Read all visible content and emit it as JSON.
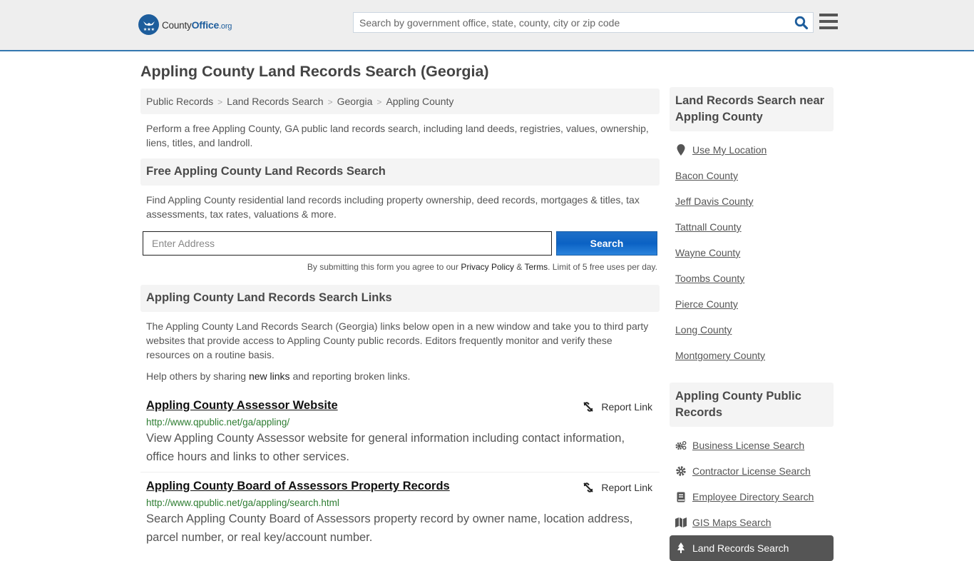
{
  "header": {
    "logo": {
      "county": "County",
      "office": "Office",
      "tld": ".org"
    },
    "search_placeholder": "Search by government office, state, county, city or zip code",
    "accent_color": "#1d5d9c"
  },
  "page_title": "Appling County Land Records Search (Georgia)",
  "breadcrumb": [
    "Public Records",
    "Land Records Search",
    "Georgia",
    "Appling County"
  ],
  "intro": "Perform a free Appling County, GA public land records search, including land deeds, registries, values, ownership, liens, titles, and landroll.",
  "free_search": {
    "heading": "Free Appling County Land Records Search",
    "description": "Find Appling County residential land records including property ownership, deed records, mortgages & titles, tax assessments, tax rates, valuations & more.",
    "address_placeholder": "Enter Address",
    "button_label": "Search",
    "terms_prefix": "By submitting this form you agree to our ",
    "privacy_label": "Privacy Policy",
    "amp": " & ",
    "terms_label": "Terms",
    "terms_suffix": ". Limit of 5 free uses per day."
  },
  "links_section": {
    "heading": "Appling County Land Records Search Links",
    "description": "The Appling County Land Records Search (Georgia) links below open in a new window and take you to third party websites that provide access to Appling County public records. Editors frequently monitor and verify these resources on a routine basis.",
    "help_prefix": "Help others by sharing ",
    "help_link": "new links",
    "help_suffix": " and reporting broken links.",
    "report_label": "Report Link",
    "items": [
      {
        "title": "Appling County Assessor Website",
        "url": "http://www.qpublic.net/ga/appling/",
        "description": "View Appling County Assessor website for general information including contact information, office hours and links to other services."
      },
      {
        "title": "Appling County Board of Assessors Property Records",
        "url": "http://www.qpublic.net/ga/appling/search.html",
        "description": "Search Appling County Board of Assessors property record by owner name, location address, parcel number, or real key/account number."
      }
    ]
  },
  "sidebar": {
    "nearby_heading": "Land Records Search near Appling County",
    "use_location": "Use My Location",
    "nearby": [
      "Bacon County",
      "Jeff Davis County",
      "Tattnall County",
      "Wayne County",
      "Toombs County",
      "Pierce County",
      "Long County",
      "Montgomery County"
    ],
    "public_heading": "Appling County Public Records",
    "public_records": [
      {
        "label": "Business License Search",
        "icon": "gears-icon"
      },
      {
        "label": "Contractor License Search",
        "icon": "gear-icon"
      },
      {
        "label": "Employee Directory Search",
        "icon": "book-icon"
      },
      {
        "label": "GIS Maps Search",
        "icon": "map-icon"
      }
    ],
    "active_item": {
      "label": "Land Records Search",
      "icon": "tree-icon"
    }
  }
}
